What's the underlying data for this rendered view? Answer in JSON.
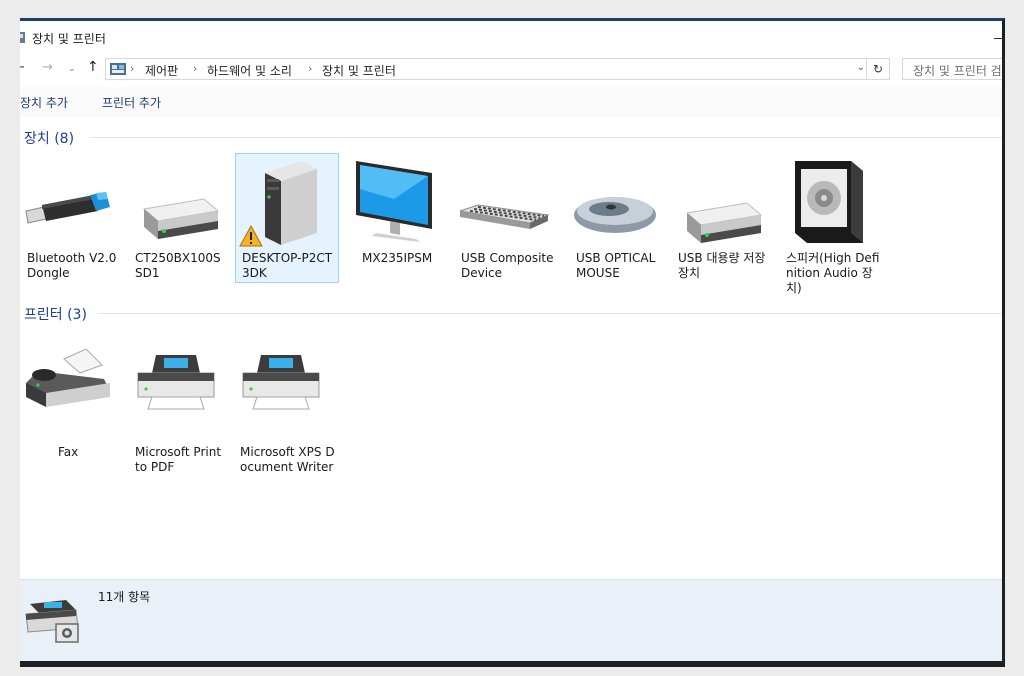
{
  "window": {
    "title": "장치 및 프린터"
  },
  "nav": {
    "back": "←",
    "forward": "→",
    "recent": "⌄",
    "up": "↑"
  },
  "address": {
    "crumbs": [
      "제어판",
      "하드웨어 및 소리",
      "장치 및 프린터"
    ],
    "separator": "›",
    "dropdown": "⌄",
    "refresh": "↻"
  },
  "search": {
    "placeholder": "장치 및 프린터 검"
  },
  "commands": {
    "add_device": "장치 추가",
    "add_printer": "프린터 추가"
  },
  "groups": {
    "devices": {
      "title": "장치 (8)"
    },
    "printers": {
      "title": "프린터 (3)"
    }
  },
  "devices": [
    {
      "label": "Bluetooth V2.0 Dongle",
      "icon": "usb-dongle-icon"
    },
    {
      "label": "CT250BX100SSD1",
      "icon": "drive-icon"
    },
    {
      "label": "DESKTOP-P2CT3DK",
      "icon": "computer-tower-icon",
      "warning": true,
      "selected": true
    },
    {
      "label": "MX235IPSM",
      "icon": "monitor-icon"
    },
    {
      "label": "USB Composite Device",
      "icon": "keyboard-icon"
    },
    {
      "label": "USB OPTICAL MOUSE",
      "icon": "mouse-icon"
    },
    {
      "label": "USB 대용량 저장 장치",
      "icon": "drive-icon"
    },
    {
      "label": "스피커(High Definition Audio 장치)",
      "icon": "speaker-icon"
    }
  ],
  "printers": [
    {
      "label": "Fax",
      "icon": "fax-icon"
    },
    {
      "label": "Microsoft Print to PDF",
      "icon": "printer-icon"
    },
    {
      "label": "Microsoft XPS Document Writer",
      "icon": "printer-icon"
    }
  ],
  "status": {
    "count": "11개 항목",
    "icon": "printer-camera-icon"
  },
  "colors": {
    "accent": "#1e3f91",
    "status_bg": "#eaf0f7",
    "selection": "#e5f3ff"
  }
}
